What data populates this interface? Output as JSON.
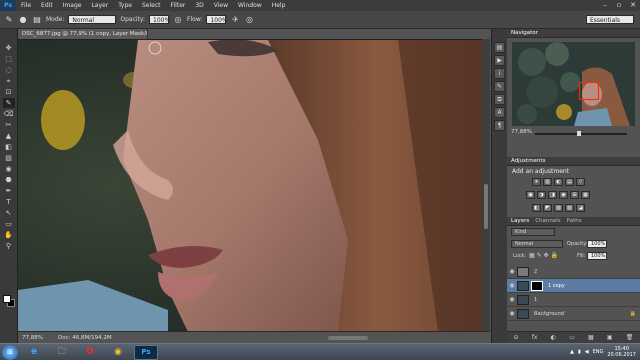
{
  "menubar": {
    "logo": "Ps",
    "items": [
      "File",
      "Edit",
      "Image",
      "Layer",
      "Type",
      "Select",
      "Filter",
      "3D",
      "View",
      "Window",
      "Help"
    ],
    "controls": [
      "–",
      "▫",
      "✕"
    ]
  },
  "options": {
    "mode_label": "Mode:",
    "mode_value": "Normal",
    "opacity_label": "Opacity:",
    "opacity_value": "100%",
    "flow_label": "Flow:",
    "flow_value": "100%",
    "workspace": "Essentials"
  },
  "document": {
    "tab_title": "DSC_6877.jpg @ 77,9% (1 copy, Layer Mask/8) *",
    "zoom": "77,88%",
    "doc_info": "Doc: 46,8M/194,2M"
  },
  "navigator": {
    "tab": "Navigator",
    "zoom": "77,88%"
  },
  "adjustments": {
    "tab": "Adjustments",
    "title": "Add an adjustment",
    "row1": [
      "☀",
      "▥",
      "◐",
      "▤",
      "▽"
    ],
    "row2": [
      "▣",
      "◑",
      "◨",
      "◉",
      "⊞",
      "▦"
    ],
    "row3": [
      "◧",
      "◩",
      "▨",
      "▧",
      "◪"
    ]
  },
  "layers": {
    "tabs": [
      "Layers",
      "Channels",
      "Paths"
    ],
    "kind_label": "Kind",
    "blend_mode": "Normal",
    "opacity_label": "Opacity:",
    "opacity_value": "100%",
    "lock_label": "Lock:",
    "fill_label": "Fill:",
    "fill_value": "100%",
    "rows": [
      {
        "name": "2",
        "selected": false
      },
      {
        "name": "1 copy",
        "selected": true
      },
      {
        "name": "1",
        "selected": false
      },
      {
        "name": "Background",
        "selected": false
      }
    ],
    "footer_icons": [
      "⊝",
      "fx",
      "◐",
      "▭",
      "▦",
      "▣",
      "🗑"
    ]
  },
  "toolbar": {
    "tools": [
      "✥",
      "⬚",
      "◌",
      "⌖",
      "⊡",
      "✎",
      "⌫",
      "✂",
      "▲",
      "◧",
      "▨",
      "◉",
      "⬣",
      "✒",
      "T",
      "↖",
      "▭",
      "✋",
      "⚲"
    ]
  },
  "taskbar": {
    "apps": [
      "e",
      "🗀",
      "O",
      "◉",
      "Ps"
    ],
    "lang": "ENG",
    "time": "15:40",
    "date": "20.06.2017"
  },
  "colors": {
    "accent": "#31a8ff",
    "selected_layer": "#5d7ca3",
    "nav_box": "#ff2a00"
  }
}
